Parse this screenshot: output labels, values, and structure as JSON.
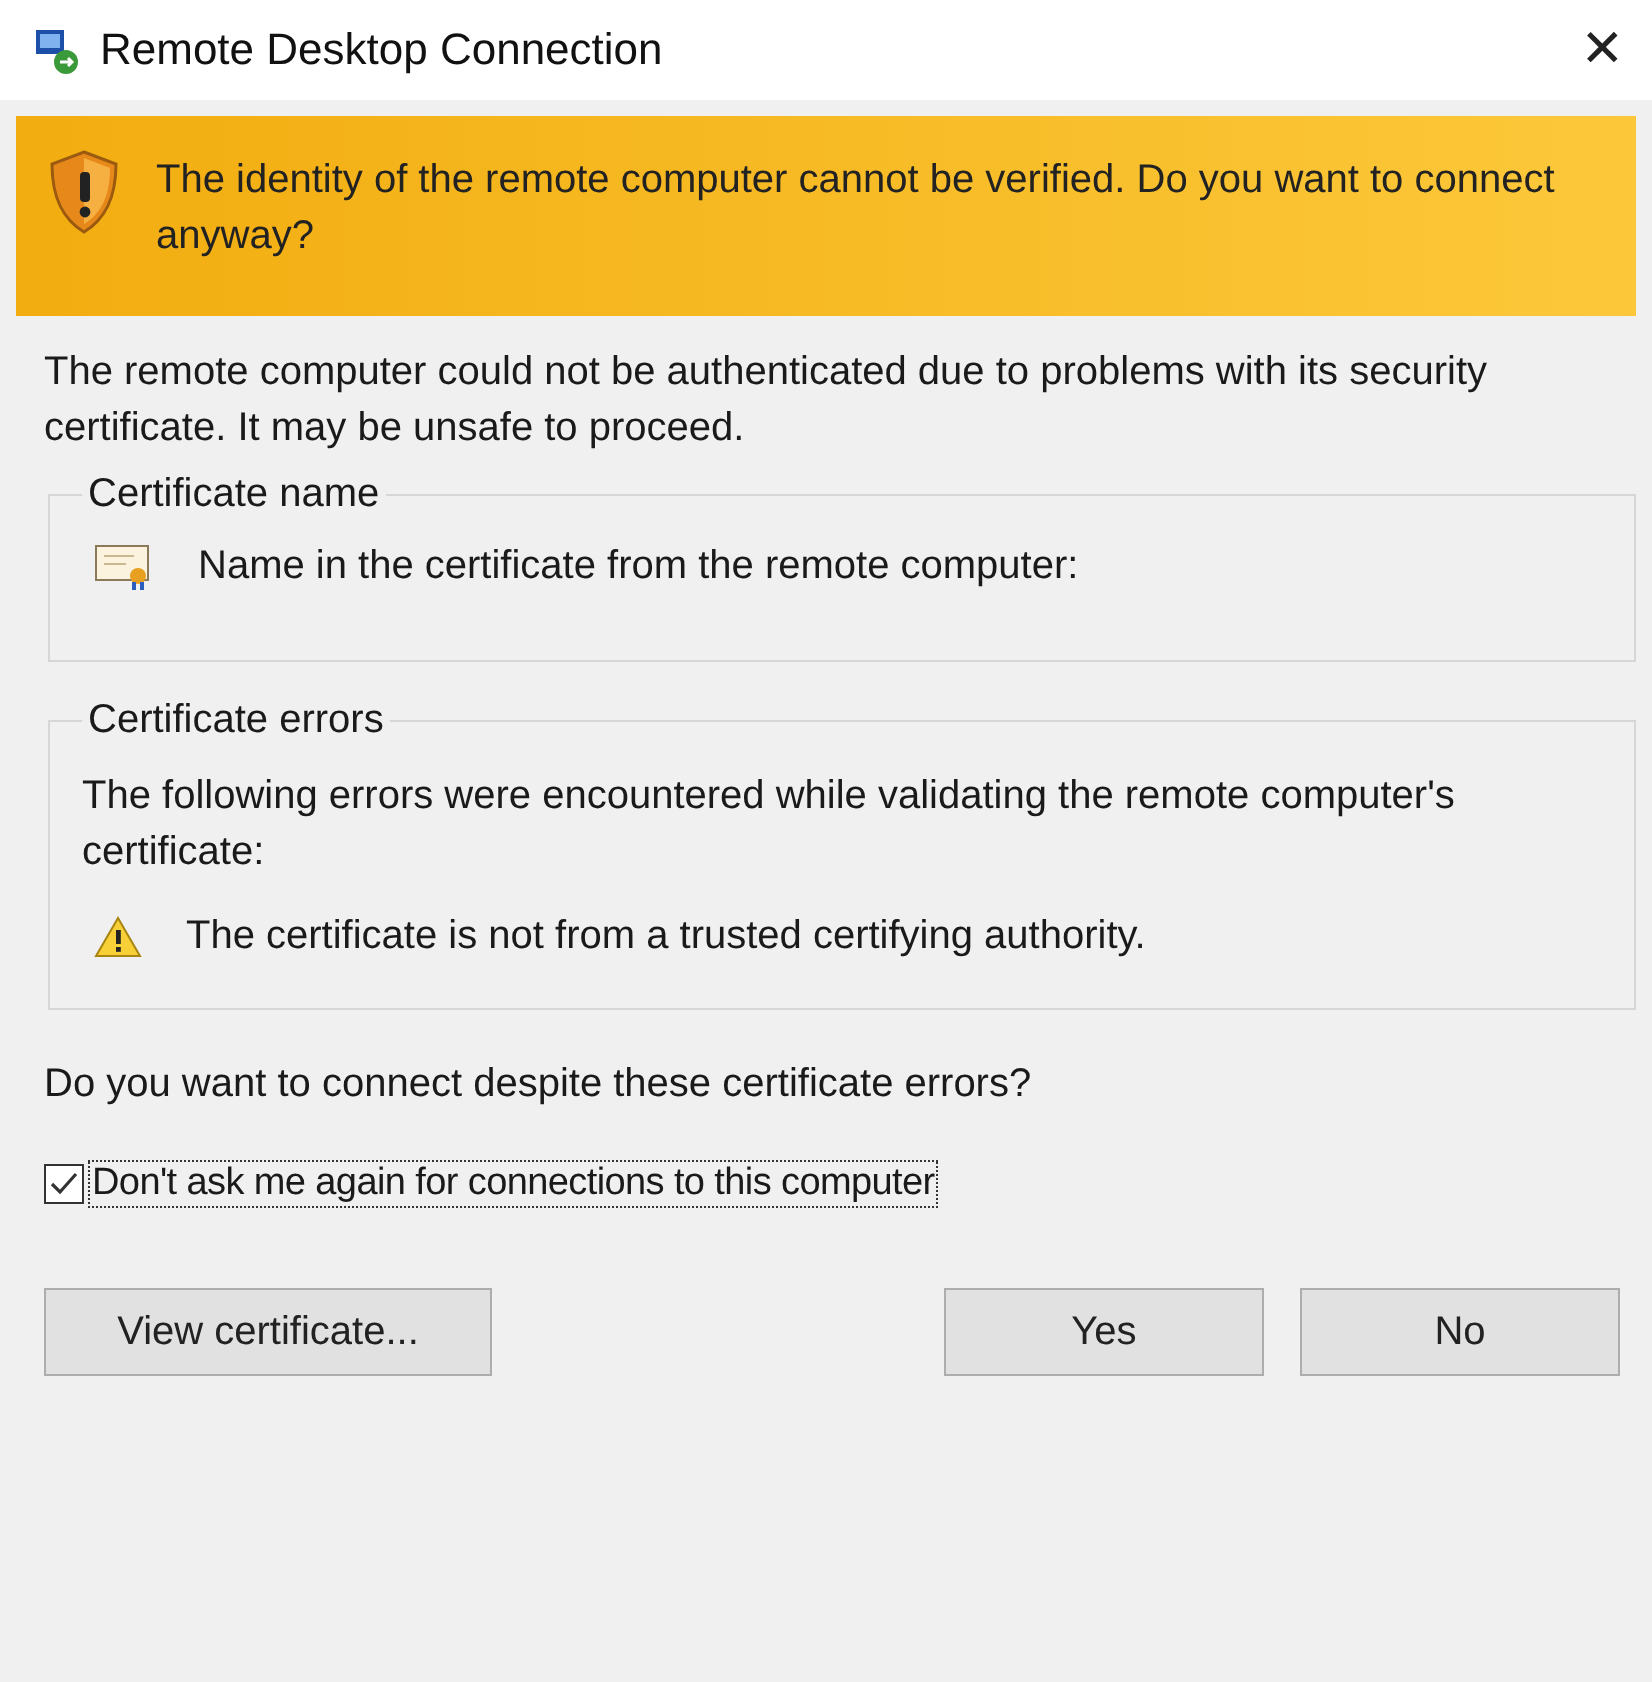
{
  "window": {
    "title": "Remote Desktop Connection",
    "close": "✕"
  },
  "banner": {
    "text": "The identity of the remote computer cannot be verified. Do you want to connect anyway?"
  },
  "intro": "The remote computer could not be authenticated due to problems with its security certificate. It may be unsafe to proceed.",
  "groups": [
    {
      "kind": "name",
      "title": "Certificate name",
      "label": "Name in the certificate from the remote computer:"
    },
    {
      "kind": "errors",
      "title": "Certificate errors",
      "label": "The following errors were encountered while validating the remote computer's certificate:",
      "errors": [
        "The certificate is not from a trusted certifying authority."
      ]
    }
  ],
  "question": "Do you want to connect despite these certificate errors?",
  "checkbox": {
    "label": "Don't ask me again for connections to this computer",
    "checked": true
  },
  "buttons": [
    {
      "label": "View certificate...",
      "kind": "left"
    },
    {
      "label": "Yes",
      "kind": "right"
    },
    {
      "label": "No",
      "kind": "right"
    }
  ]
}
